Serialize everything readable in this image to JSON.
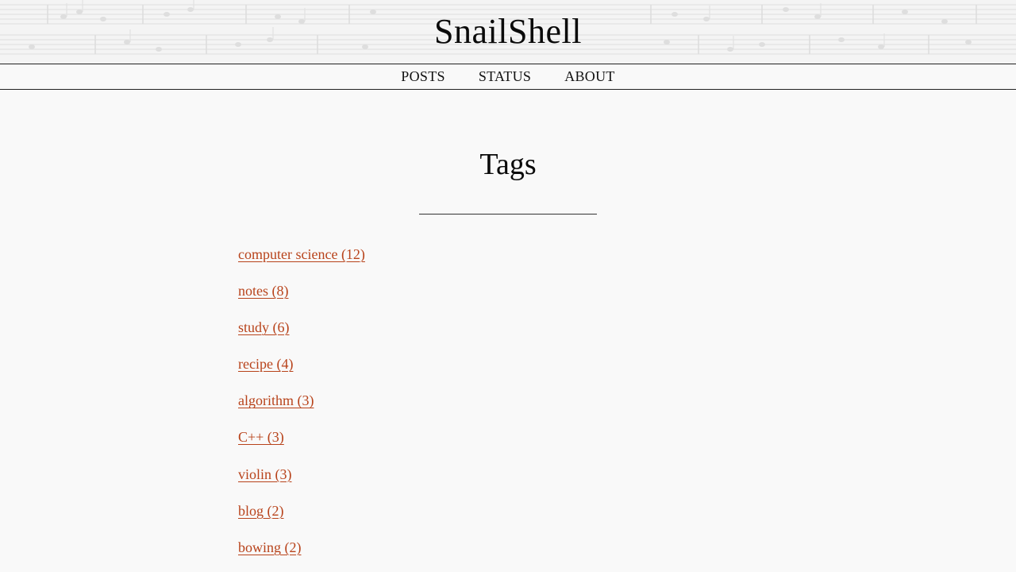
{
  "site": {
    "title": "SnailShell"
  },
  "nav": {
    "items": [
      {
        "label": "POSTS"
      },
      {
        "label": "STATUS"
      },
      {
        "label": "ABOUT"
      }
    ]
  },
  "main": {
    "title": "Tags",
    "tags": [
      {
        "label": "computer science (12)"
      },
      {
        "label": "notes (8)"
      },
      {
        "label": "study (6)"
      },
      {
        "label": "recipe (4)"
      },
      {
        "label": "algorithm (3)"
      },
      {
        "label": "C++ (3)"
      },
      {
        "label": "violin (3)"
      },
      {
        "label": "blog (2)"
      },
      {
        "label": "bowing (2)"
      }
    ]
  },
  "colors": {
    "link": "#b8431b",
    "background": "#f9f9f9",
    "text": "#111111"
  }
}
